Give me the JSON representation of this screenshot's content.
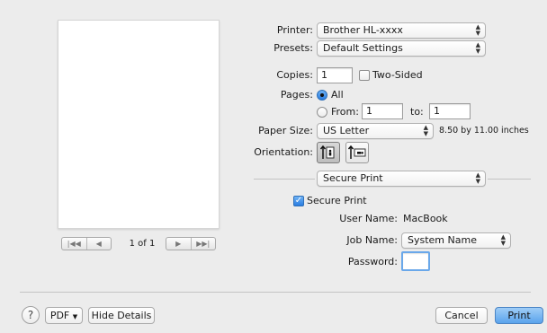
{
  "preview": {
    "page_indicator": "1 of 1"
  },
  "printer": {
    "label": "Printer:",
    "value": "Brother HL-xxxx"
  },
  "presets": {
    "label": "Presets:",
    "value": "Default Settings"
  },
  "copies": {
    "label": "Copies:",
    "value": "1",
    "two_sided_label": "Two-Sided",
    "two_sided_checked": false
  },
  "pages": {
    "label": "Pages:",
    "all_label": "All",
    "from_label": "From:",
    "from_value": "1",
    "to_label": "to:",
    "to_value": "1",
    "selected": "All"
  },
  "paper_size": {
    "label": "Paper Size:",
    "value": "US Letter",
    "dimensions": "8.50 by 11.00 inches"
  },
  "orientation": {
    "label": "Orientation:",
    "selected": "portrait"
  },
  "section_popup": {
    "value": "Secure Print"
  },
  "secure_print": {
    "checkbox_label": "Secure Print",
    "checked": true,
    "user_name_label": "User Name:",
    "user_name_value": "MacBook",
    "job_name_label": "Job Name:",
    "job_name_value": "System Name",
    "password_label": "Password:",
    "password_value": ""
  },
  "footer": {
    "help_label": "?",
    "pdf_label": "PDF",
    "hide_details_label": "Hide Details",
    "cancel_label": "Cancel",
    "print_label": "Print"
  },
  "colors": {
    "accent": "#2a7de1",
    "default_button": "#5aa3ec",
    "window_bg": "#ececec"
  }
}
